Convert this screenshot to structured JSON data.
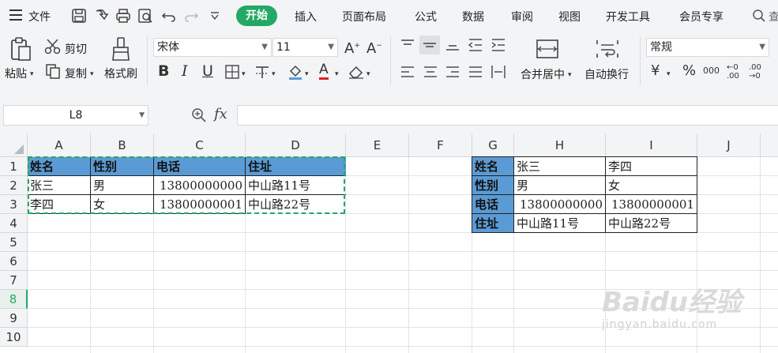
{
  "menu": {
    "file_label": "文件",
    "tabs": [
      "开始",
      "插入",
      "页面布局",
      "公式",
      "数据",
      "审阅",
      "视图",
      "开发工具",
      "会员专享"
    ],
    "search_partial": "查"
  },
  "ribbon": {
    "paste_label": "粘贴",
    "cut_label": "剪切",
    "copy_label": "复制",
    "format_painter_label": "格式刷",
    "font_name": "宋体",
    "font_size": "11",
    "merge_label": "合并居中",
    "wrap_label": "自动换行",
    "number_format": "常规",
    "currency_symbol": "¥",
    "percent_symbol": "%",
    "thousands_symbol": "000",
    "dec_inc": "←0 .00",
    "dec_dec": ".00 →0"
  },
  "formula_bar": {
    "name_box": "L8",
    "fx_label": "fx",
    "value": ""
  },
  "sheet": {
    "columns": [
      "A",
      "B",
      "C",
      "D",
      "E",
      "F",
      "G",
      "H",
      "I",
      "J"
    ],
    "rows": [
      "1",
      "2",
      "3",
      "4",
      "5",
      "6",
      "7",
      "8",
      "9",
      "10"
    ],
    "selected_row": "8",
    "table1": {
      "headers": [
        "姓名",
        "性别",
        "电话",
        "住址"
      ],
      "rows": [
        [
          "张三",
          "男",
          "13800000000",
          "中山路11号"
        ],
        [
          "李四",
          "女",
          "13800000001",
          "中山路22号"
        ]
      ]
    },
    "table2": {
      "labels": [
        "姓名",
        "性别",
        "电话",
        "住址"
      ],
      "col_h": [
        "张三",
        "男",
        "13800000000",
        "中山路11号"
      ],
      "col_i": [
        "李四",
        "女",
        "13800000001",
        "中山路22号"
      ]
    }
  },
  "watermark": {
    "brand": "Baidu经验",
    "url": "jingyan.baidu.com"
  },
  "colors": {
    "accent": "#24a866",
    "header_fill": "#5b9bd5",
    "chrome": "#f3f4f6"
  }
}
